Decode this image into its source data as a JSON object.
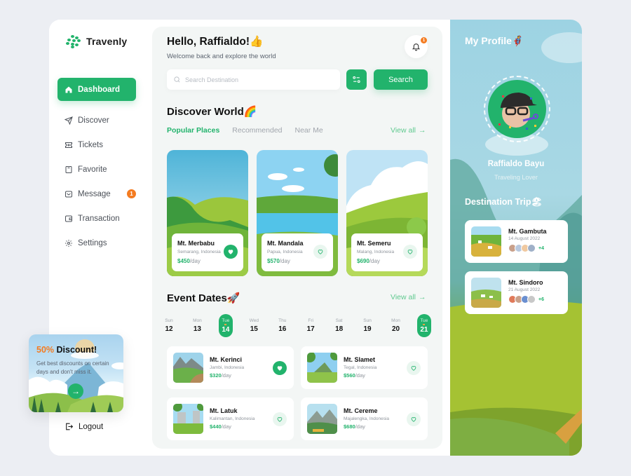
{
  "app": {
    "name": "Travenly"
  },
  "sidebar": {
    "items": [
      {
        "label": "Dashboard",
        "icon": "home-icon",
        "active": true
      },
      {
        "label": "Discover",
        "icon": "send-icon"
      },
      {
        "label": "Tickets",
        "icon": "ticket-icon"
      },
      {
        "label": "Favorite",
        "icon": "bookmark-icon"
      },
      {
        "label": "Message",
        "icon": "message-icon",
        "badge": "1"
      },
      {
        "label": "Transaction",
        "icon": "wallet-icon"
      },
      {
        "label": "Settings",
        "icon": "gear-icon"
      }
    ],
    "logout_label": "Logout"
  },
  "promo": {
    "highlight": "50%",
    "title_rest": " Discount!",
    "description": "Get best discounts on certain days and don't miss it."
  },
  "header": {
    "greeting": "Hello, Raffialdo!👍",
    "subtitle": "Welcome back and explore the world",
    "notification_count": "1",
    "search_placeholder": "Search Destination",
    "search_button": "Search"
  },
  "discover": {
    "title": "Discover World🌈",
    "tabs": [
      {
        "label": "Popular Places",
        "active": true
      },
      {
        "label": "Recommended"
      },
      {
        "label": "Near Me"
      }
    ],
    "view_all": "View all",
    "places": [
      {
        "name": "Mt. Merbabu",
        "location": "Semarang, Indonesia",
        "price": "$450",
        "unit": "/day",
        "favorite": true
      },
      {
        "name": "Mt. Mandala",
        "location": "Papua, Indonesia",
        "price": "$570",
        "unit": "/day",
        "favorite": false
      },
      {
        "name": "Mt. Semeru",
        "location": "Malang, Indonesia",
        "price": "$690",
        "unit": "/day",
        "favorite": false
      }
    ]
  },
  "events": {
    "title": "Event Dates🚀",
    "view_all": "View all",
    "dates": [
      {
        "day": "Sun",
        "num": "12"
      },
      {
        "day": "Mon",
        "num": "13"
      },
      {
        "day": "Tue",
        "num": "14",
        "active": true
      },
      {
        "day": "Wed",
        "num": "15"
      },
      {
        "day": "Thu",
        "num": "16"
      },
      {
        "day": "Fri",
        "num": "17"
      },
      {
        "day": "Sat",
        "num": "18"
      },
      {
        "day": "Sun",
        "num": "19"
      },
      {
        "day": "Mon",
        "num": "20"
      },
      {
        "day": "Tue",
        "num": "21",
        "active": true
      }
    ],
    "items": [
      {
        "name": "Mt. Kerinci",
        "location": "Jambi, Indonesia",
        "price": "$320",
        "unit": "/day",
        "favorite": true
      },
      {
        "name": "Mt. Slamet",
        "location": "Tegal, Indonesia",
        "price": "$560",
        "unit": "/day",
        "favorite": false
      },
      {
        "name": "Mt. Latuk",
        "location": "Kalimantan, Indonesia",
        "price": "$440",
        "unit": "/day",
        "favorite": false
      },
      {
        "name": "Mt. Cereme",
        "location": "Majalengka, Indonesia",
        "price": "$680",
        "unit": "/day",
        "favorite": false
      }
    ]
  },
  "profile": {
    "title": "My Profile🦸",
    "name": "Raffialdo Bayu",
    "role": "Traveling Lover",
    "trips_title": "Destination Trip🏖",
    "trips": [
      {
        "name": "Mt. Gambuta",
        "date": "14 August 2022",
        "more": "+4"
      },
      {
        "name": "Mt. Sindoro",
        "date": "21 August 2022",
        "more": "+6"
      }
    ]
  },
  "colors": {
    "accent": "#22b36c",
    "badge": "#f47b20"
  }
}
